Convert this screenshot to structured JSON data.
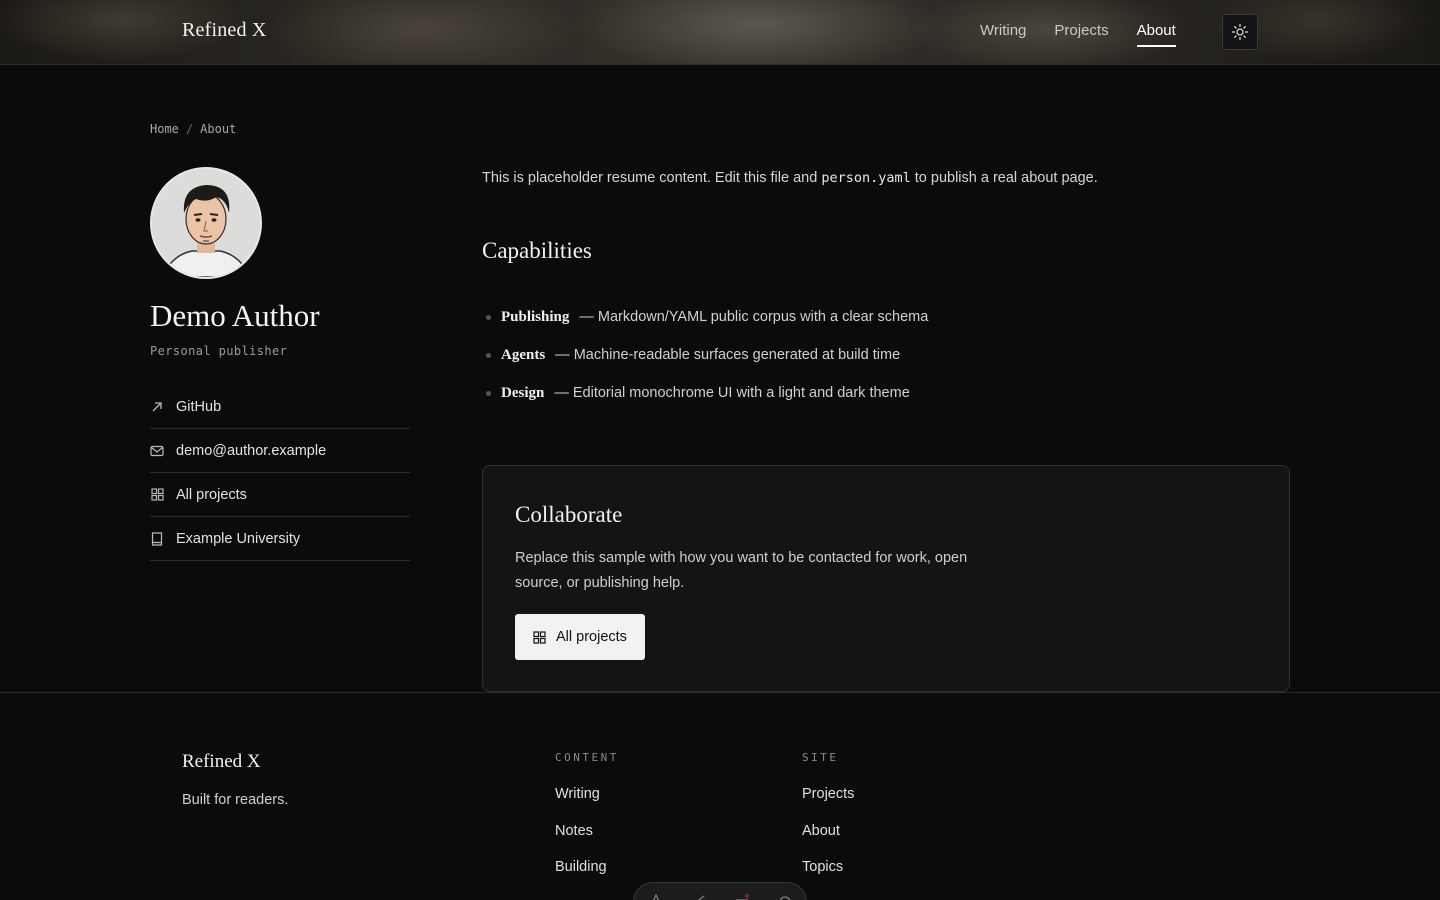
{
  "header": {
    "brand": "Refined X",
    "nav": [
      {
        "label": "Writing",
        "active": false
      },
      {
        "label": "Projects",
        "active": false
      },
      {
        "label": "About",
        "active": true
      }
    ],
    "theme_toggle_icon": "sun-icon"
  },
  "breadcrumb": {
    "home": "Home",
    "sep": "/",
    "current": "About"
  },
  "profile": {
    "name": "Demo Author",
    "role": "Personal publisher",
    "links": [
      {
        "icon": "arrow-up-right-icon",
        "label": "GitHub"
      },
      {
        "icon": "mail-icon",
        "label": "demo@author.example"
      },
      {
        "icon": "grid-icon",
        "label": "All projects"
      },
      {
        "icon": "book-icon",
        "label": "Example University"
      }
    ]
  },
  "intro": {
    "before": "This is placeholder resume content. Edit this file and ",
    "code": "person.yaml",
    "after": " to publish a real about page."
  },
  "capabilities": {
    "title": "Capabilities",
    "items": [
      {
        "term": "Publishing",
        "desc": "— Markdown/YAML public corpus with a clear schema"
      },
      {
        "term": "Agents",
        "desc": "— Machine-readable surfaces generated at build time"
      },
      {
        "term": "Design",
        "desc": "— Editorial monochrome UI with a light and dark theme"
      }
    ]
  },
  "collaborate": {
    "title": "Collaborate",
    "text": "Replace this sample with how you want to be contacted for work, open source, or publishing help.",
    "button": "All projects"
  },
  "footer": {
    "brand": "Refined X",
    "tagline": "Built for readers.",
    "columns": [
      {
        "heading": "CONTENT",
        "items": [
          "Writing",
          "Notes",
          "Building"
        ]
      },
      {
        "heading": "SITE",
        "items": [
          "Projects",
          "About",
          "Topics"
        ]
      }
    ]
  },
  "colors": {
    "background": "#0b0b0d",
    "accent": "#f2f2f2",
    "border": "#2a2a2e"
  }
}
